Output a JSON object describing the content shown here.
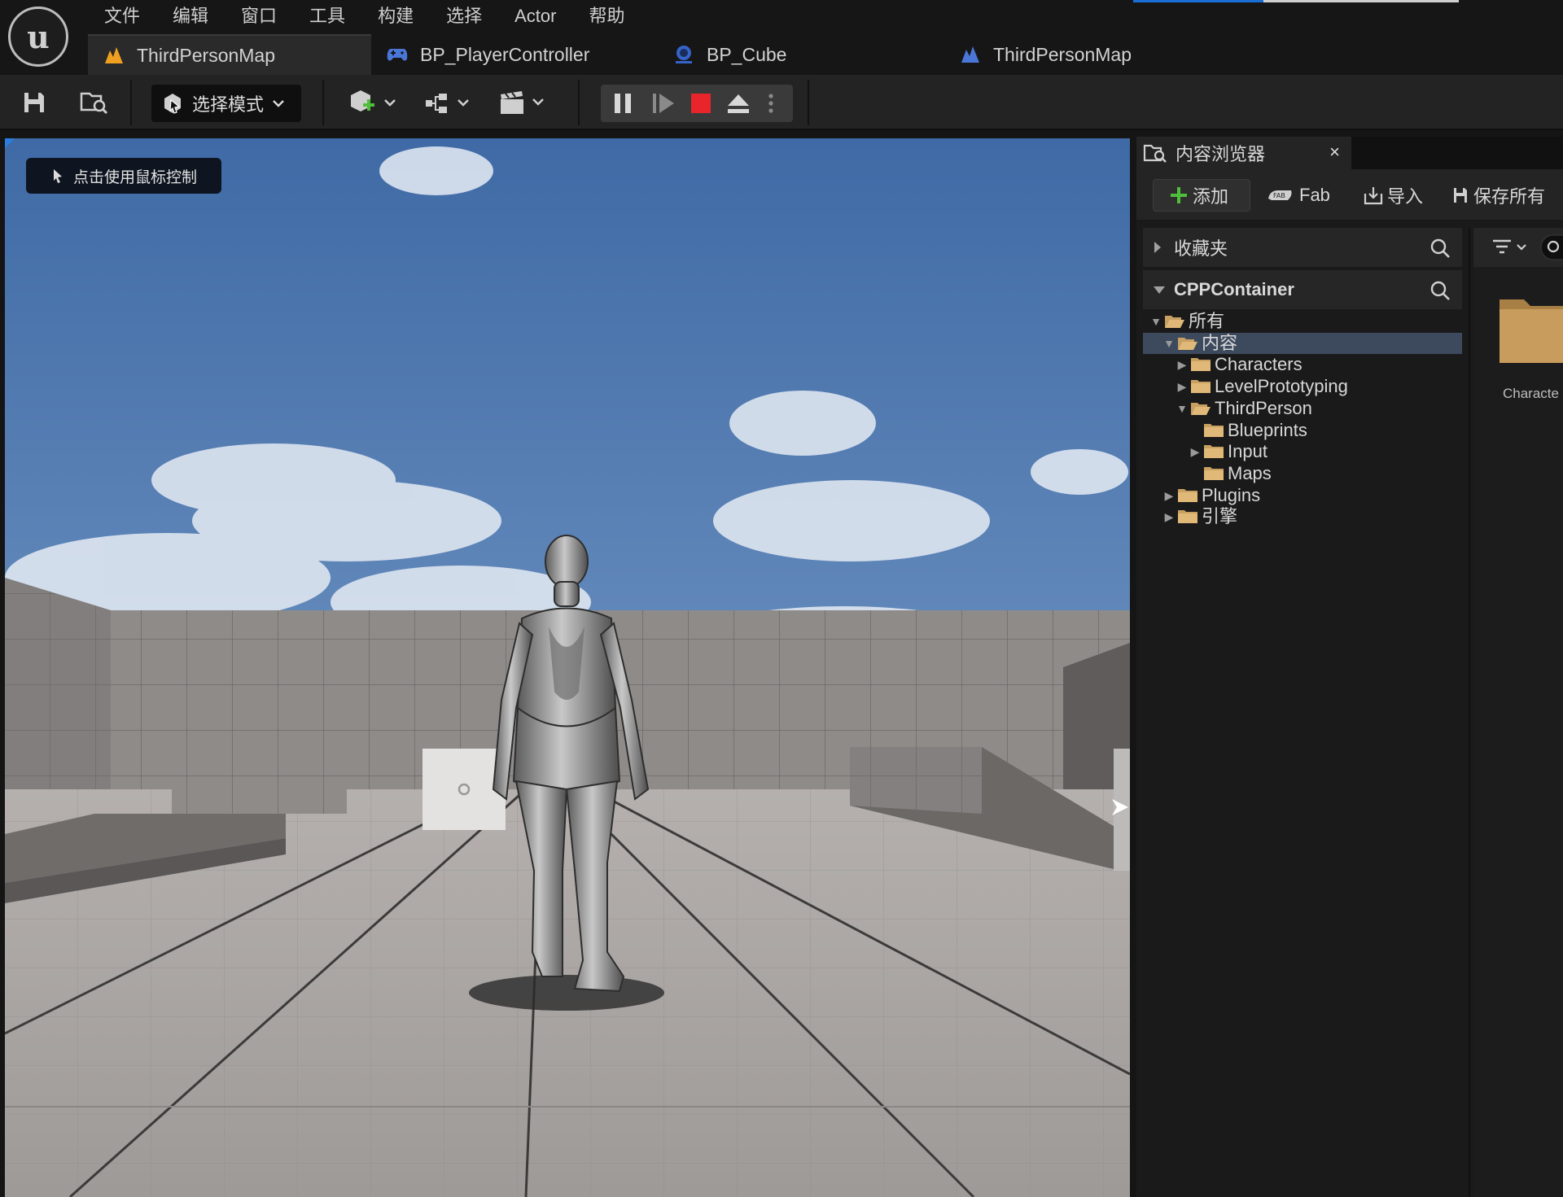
{
  "menu": [
    "文件",
    "编辑",
    "窗口",
    "工具",
    "构建",
    "选择",
    "Actor",
    "帮助"
  ],
  "title_progress": 0.4,
  "tabs": [
    {
      "label": "ThirdPersonMap",
      "icon": "level-icon",
      "active": true
    },
    {
      "label": "BP_PlayerController",
      "icon": "gamepad-icon",
      "active": false
    },
    {
      "label": "BP_Cube",
      "icon": "blueprint-actor-icon",
      "active": false
    },
    {
      "label": "ThirdPersonMap",
      "icon": "level-icon",
      "active": false
    }
  ],
  "toolbar": {
    "mode_label": "选择模式",
    "icons": [
      "save-icon",
      "browse-icon",
      "add-actor-icon",
      "blueprint-icon",
      "cinematics-icon",
      "pause-icon",
      "step-icon",
      "stop-icon",
      "eject-icon",
      "more-icon"
    ]
  },
  "viewport": {
    "hint": "点击使用鼠标控制"
  },
  "content_browser": {
    "tab_title": "内容浏览器",
    "close": "×",
    "actions": {
      "add": "添加",
      "fab": "Fab",
      "import": "导入",
      "save_all": "保存所有"
    },
    "favorites": "收藏夹",
    "project": "CPPContainer",
    "tree": [
      {
        "label": "所有",
        "depth": 0,
        "expanded": true,
        "selected": false
      },
      {
        "label": "内容",
        "depth": 1,
        "expanded": true,
        "selected": true
      },
      {
        "label": "Characters",
        "depth": 2,
        "expanded": false,
        "selected": false
      },
      {
        "label": "LevelPrototyping",
        "depth": 2,
        "expanded": false,
        "selected": false
      },
      {
        "label": "ThirdPerson",
        "depth": 2,
        "expanded": true,
        "selected": false
      },
      {
        "label": "Blueprints",
        "depth": 3,
        "expanded": null,
        "selected": false
      },
      {
        "label": "Input",
        "depth": 3,
        "expanded": false,
        "selected": false
      },
      {
        "label": "Maps",
        "depth": 3,
        "expanded": null,
        "selected": false
      },
      {
        "label": "Plugins",
        "depth": 1,
        "expanded": false,
        "selected": false
      },
      {
        "label": "引擎",
        "depth": 1,
        "expanded": false,
        "selected": false
      }
    ],
    "thumb_label": "Characte"
  },
  "colors": {
    "accent": "#1a6fd6",
    "stop": "#e8252b",
    "add": "#4fbf3b",
    "folder": "#c8a062",
    "selection": "#3d4a5e"
  }
}
